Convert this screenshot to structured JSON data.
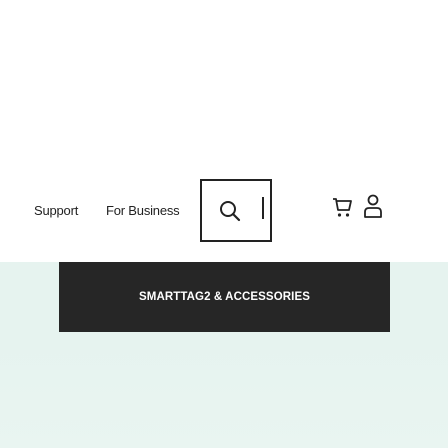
{
  "nav": {
    "links": [
      {
        "label": "Support"
      },
      {
        "label": "For Business"
      }
    ],
    "icons": {
      "search": "search-icon",
      "cart": "cart-icon",
      "account": "account-icon"
    }
  },
  "promo": {
    "label": "SMARTTAG2 & ACCESSORIES"
  },
  "colors": {
    "text": "#222222",
    "promo_bar": "#262626",
    "promo_text": "#ffffff",
    "background_tint": "#e6f3ef"
  }
}
